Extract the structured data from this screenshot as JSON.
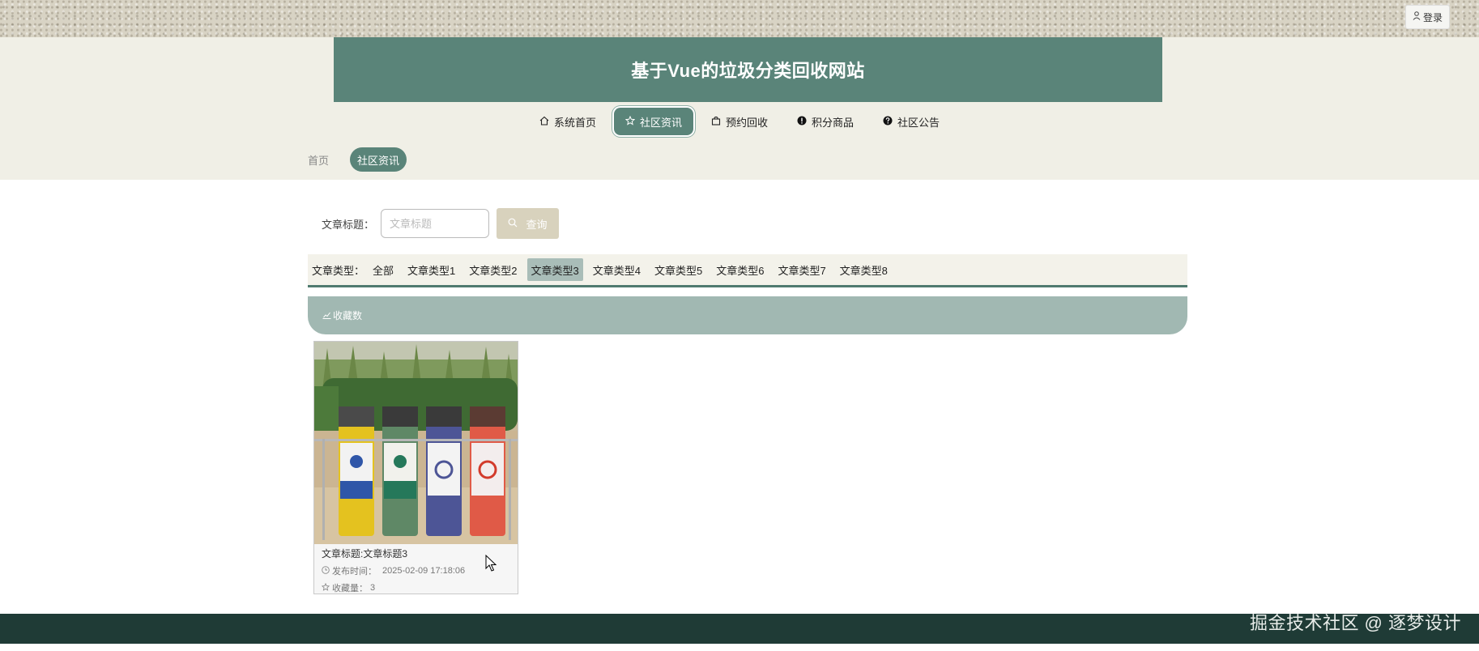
{
  "header": {
    "login_label": "登录",
    "site_title": "基于Vue的垃圾分类回收网站"
  },
  "nav": {
    "items": [
      {
        "label": "系统首页",
        "icon": "home-icon",
        "active": false
      },
      {
        "label": "社区资讯",
        "icon": "star-icon",
        "active": true
      },
      {
        "label": "预约回收",
        "icon": "bag-icon",
        "active": false
      },
      {
        "label": "积分商品",
        "icon": "info-circle-icon",
        "active": false
      },
      {
        "label": "社区公告",
        "icon": "question-circle-icon",
        "active": false
      }
    ]
  },
  "breadcrumb": {
    "home": "首页",
    "current": "社区资讯"
  },
  "search": {
    "label": "文章标题：",
    "placeholder": "文章标题",
    "button_label": "查询"
  },
  "types": {
    "label": "文章类型：",
    "items": [
      "全部",
      "文章类型1",
      "文章类型2",
      "文章类型3",
      "文章类型4",
      "文章类型5",
      "文章类型6",
      "文章类型7",
      "文章类型8"
    ],
    "selected": "文章类型3"
  },
  "sort": {
    "label": "收藏数"
  },
  "articles": [
    {
      "title": "文章标题:文章标题3",
      "published_label": "发布时间：",
      "published": "2025-02-09 17:18:06",
      "favorites_label": "收藏量：",
      "favorites": "3"
    }
  ],
  "watermark": "掘金技术社区 @ 逐梦设计",
  "colors": {
    "accent": "#5a8479",
    "cream": "#f0efe6",
    "sort_bar": "#a1b8b2",
    "footer": "#1f3b36"
  }
}
